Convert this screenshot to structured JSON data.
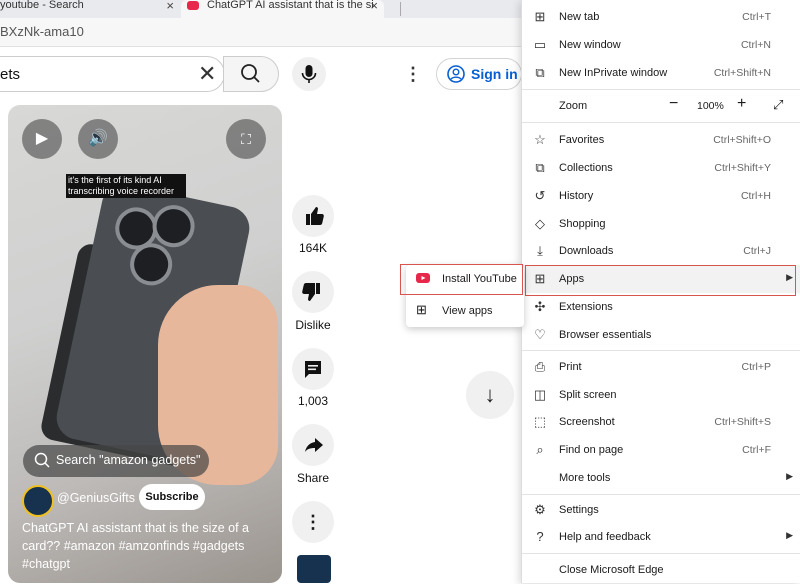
{
  "browser": {
    "tabs": [
      {
        "label": "youtube - Search"
      },
      {
        "label": "ChatGPT AI assistant that is the si"
      }
    ],
    "address": "BXzNk-ama10"
  },
  "youtube": {
    "search_query": "ets",
    "sign_in_label": "Sign in",
    "video": {
      "caption": "it's the first of its kind AI transcribing voice recorder",
      "search_chip": "Search \"amazon gadgets\"",
      "channel": "@GeniusGifts",
      "subscribe_label": "Subscribe",
      "description": "ChatGPT AI assistant that is the size of a card?? #amazon #amzonfinds #gadgets #chatgpt"
    },
    "actions": {
      "like_count": "164K",
      "dislike_label": "Dislike",
      "comment_count": "1,003",
      "share_label": "Share"
    }
  },
  "menu": {
    "items": [
      {
        "label": "New tab",
        "shortcut": "Ctrl+T"
      },
      {
        "label": "New window",
        "shortcut": "Ctrl+N"
      },
      {
        "label": "New InPrivate window",
        "shortcut": "Ctrl+Shift+N"
      },
      {
        "label": "Zoom",
        "value": "100%"
      },
      {
        "label": "Favorites",
        "shortcut": "Ctrl+Shift+O"
      },
      {
        "label": "Collections",
        "shortcut": "Ctrl+Shift+Y"
      },
      {
        "label": "History",
        "shortcut": "Ctrl+H"
      },
      {
        "label": "Shopping",
        "shortcut": ""
      },
      {
        "label": "Downloads",
        "shortcut": "Ctrl+J"
      },
      {
        "label": "Apps",
        "shortcut": ""
      },
      {
        "label": "Extensions",
        "shortcut": ""
      },
      {
        "label": "Browser essentials",
        "shortcut": ""
      },
      {
        "label": "Print",
        "shortcut": "Ctrl+P"
      },
      {
        "label": "Split screen",
        "shortcut": ""
      },
      {
        "label": "Screenshot",
        "shortcut": "Ctrl+Shift+S"
      },
      {
        "label": "Find on page",
        "shortcut": "Ctrl+F"
      },
      {
        "label": "More tools",
        "shortcut": ""
      },
      {
        "label": "Settings",
        "shortcut": ""
      },
      {
        "label": "Help and feedback",
        "shortcut": ""
      },
      {
        "label": "Close Microsoft Edge",
        "shortcut": ""
      }
    ],
    "apps_submenu": [
      {
        "label": "Install YouTube"
      },
      {
        "label": "View apps"
      }
    ]
  },
  "colors": {
    "accent": "#065fd4",
    "highlight": "#d9534f",
    "youtube_red": "#e8284a"
  }
}
